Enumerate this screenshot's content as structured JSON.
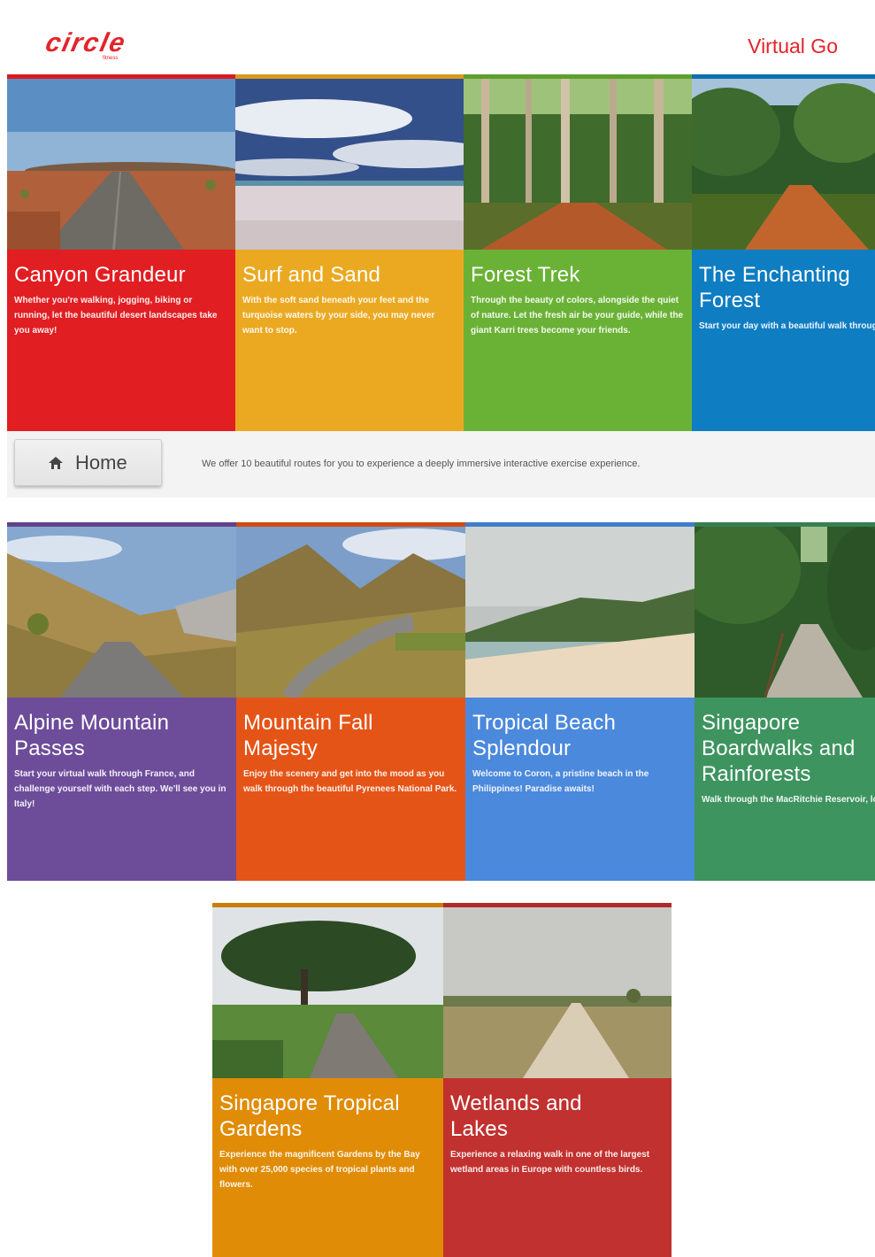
{
  "header": {
    "logo_word": "circle",
    "logo_sub": "fitness",
    "app_title": "Virtual Go"
  },
  "colors": {
    "brand": "#e4232b",
    "red": "#e11e22",
    "yellow": "#eba922",
    "green": "#6ab235",
    "blue": "#0f7dc2",
    "purple": "#6d4c9a",
    "orange": "#e55417",
    "sky": "#4b89dc",
    "forest": "#3e945f",
    "amber": "#e08c07",
    "crimson": "#c1312f"
  },
  "routes": [
    {
      "title": "Canyon Grandeur",
      "description": "Whether you're walking, jogging, biking or running, let the beautiful desert landscapes take you away!"
    },
    {
      "title": "Surf and Sand",
      "description": "With the soft sand beneath your feet and the turquoise waters by your side, you may never want to stop."
    },
    {
      "title": "Forest Trek",
      "description": "Through the beauty of colors, alongside the quiet of nature. Let the fresh air be your guide, while the giant Karri trees become your friends."
    },
    {
      "title": "The Enchanting\nForest",
      "description": "Start your day with a beautiful walk through nature, or refresh yourself after a long day of work. Adventure awaits!"
    },
    {
      "title": "Alpine Mountain\nPasses",
      "description": "Start your virtual walk through France, and challenge yourself with each step. We'll see you in Italy!"
    },
    {
      "title": "Mountain Fall\nMajesty",
      "description": "Enjoy the scenery and get into the mood as you walk through the beautiful Pyrenees National Park."
    },
    {
      "title": "Tropical Beach\nSplendour",
      "description": "Welcome to Coron, a pristine beach in the Philippines! Paradise awaits!"
    },
    {
      "title": "Singapore\nBoardwalks and\nRainforests",
      "description": "Walk through the MacRitchie Reservoir, longest boardwalk in Southeast Asia."
    },
    {
      "title": "Singapore Tropical\nGardens",
      "description": "Experience the magnificent Gardens by the Bay with over 25,000 species of tropical plants and flowers."
    },
    {
      "title": "Wetlands and\nLakes",
      "description": "Experience a relaxing walk in one of the largest wetland areas in Europe with countless birds."
    }
  ],
  "homebar": {
    "home_label": "Home",
    "home_icon": "home-icon",
    "info_text": "We offer 10 beautiful routes for you to experience a deeply immersive interactive exercise experience."
  }
}
